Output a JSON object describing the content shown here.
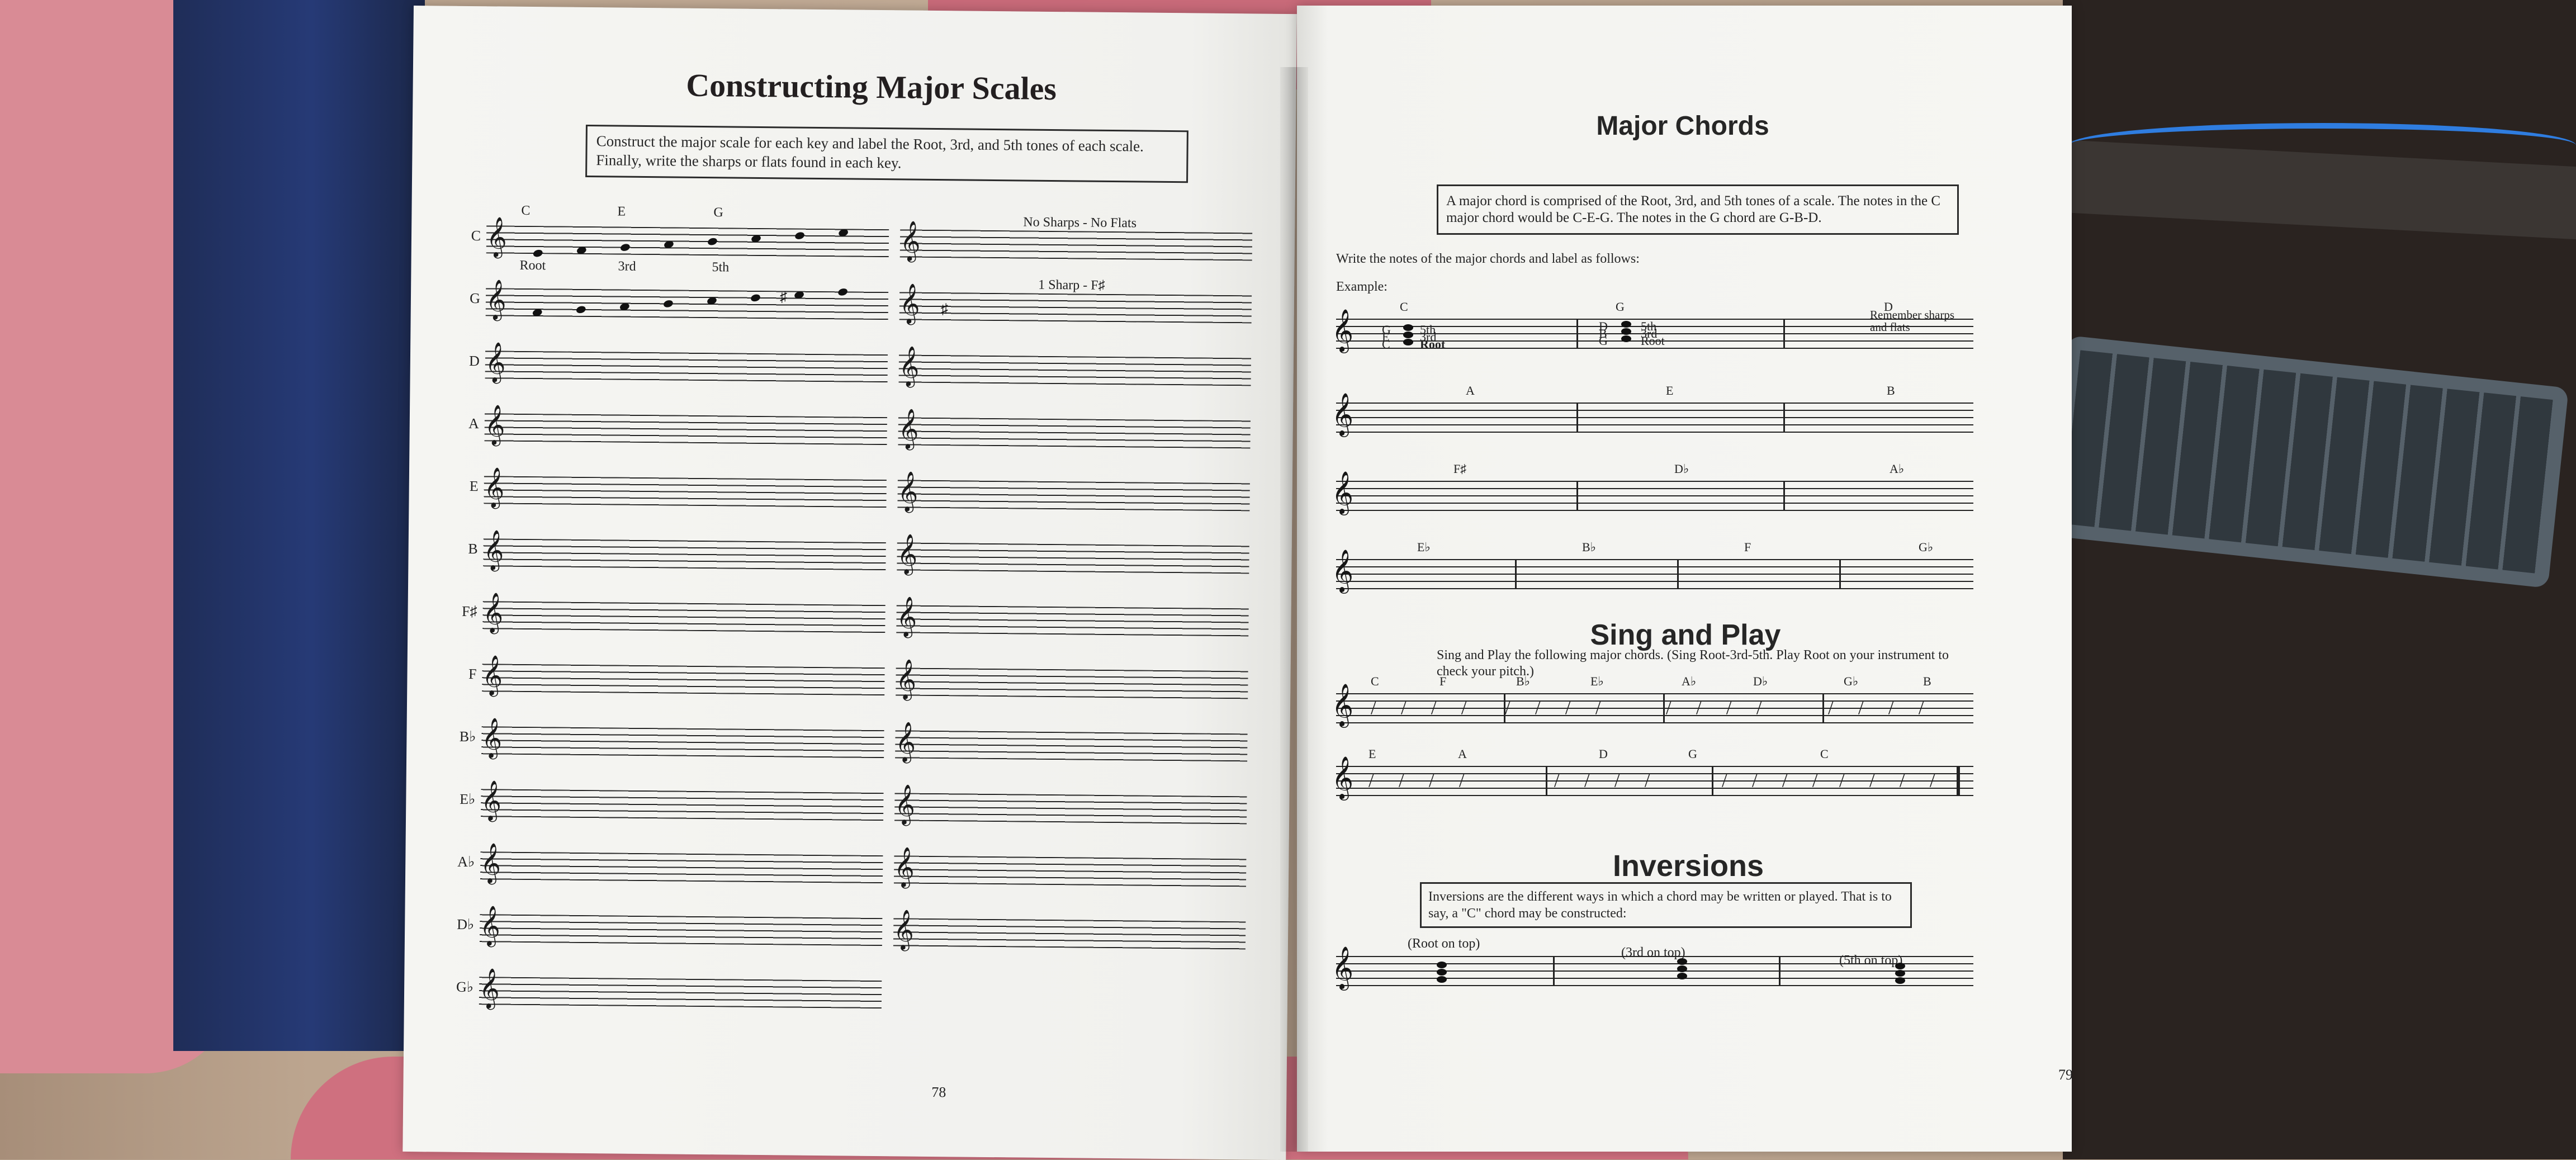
{
  "book": {
    "left_page": {
      "title": "Constructing Major Scales",
      "instruction": "Construct the major scale for each key and label the Root, 3rd, and 5th tones of each scale. Finally, write the sharps or flats found in each key.",
      "page_number": "78",
      "keys": [
        "C",
        "G",
        "D",
        "A",
        "E",
        "B",
        "F♯",
        "F",
        "B♭",
        "E♭",
        "A♭",
        "D♭",
        "G♭"
      ],
      "example_labels": {
        "c_root": "Root",
        "c_third": "3rd",
        "c_fifth": "5th",
        "c_note_c": "C",
        "c_note_e": "E",
        "c_note_g": "G",
        "c_signature": "No Sharps - No Flats",
        "g_signature": "1 Sharp - F♯"
      }
    },
    "right_page": {
      "title": "Major Chords",
      "info": "A major chord is comprised of the Root, 3rd, and 5th tones of a scale. The notes in the C major chord would be C-E-G. The notes in the G chord are G-B-D.",
      "instruction": "Write the notes of the major chords and label as follows:",
      "example_label": "Example:",
      "remember": "Remember sharps and flats",
      "chord_rows": [
        [
          "C",
          "G",
          "D"
        ],
        [
          "A",
          "E",
          "B"
        ],
        [
          "F♯",
          "D♭",
          "A♭"
        ],
        [
          "E♭",
          "B♭",
          "F",
          "G♭"
        ]
      ],
      "sample_labels": {
        "g5": "G",
        "e3": "E",
        "c1": "C",
        "d5": "D",
        "b3": "B",
        "g1": "G",
        "fifth": "5th",
        "third": "3rd",
        "root": "Root"
      },
      "sing_title": "Sing and Play",
      "sing_text": "Sing and Play the following major chords. (Sing Root-3rd-5th. Play Root on your instrument to check your pitch.)",
      "sing_row_1": [
        "C",
        "F",
        "B♭",
        "E♭",
        "A♭",
        "D♭",
        "G♭",
        "B"
      ],
      "sing_row_2": [
        "E",
        "A",
        "D",
        "G",
        "C"
      ],
      "inversions_title": "Inversions",
      "inversions_text": "Inversions are the different ways in which a chord may be written or played. That is to say, a \"C\" chord may be constructed:",
      "inversion_labels": [
        "(Root on top)",
        "(3rd on top)",
        "(5th on top)"
      ],
      "page_number": "79"
    }
  }
}
